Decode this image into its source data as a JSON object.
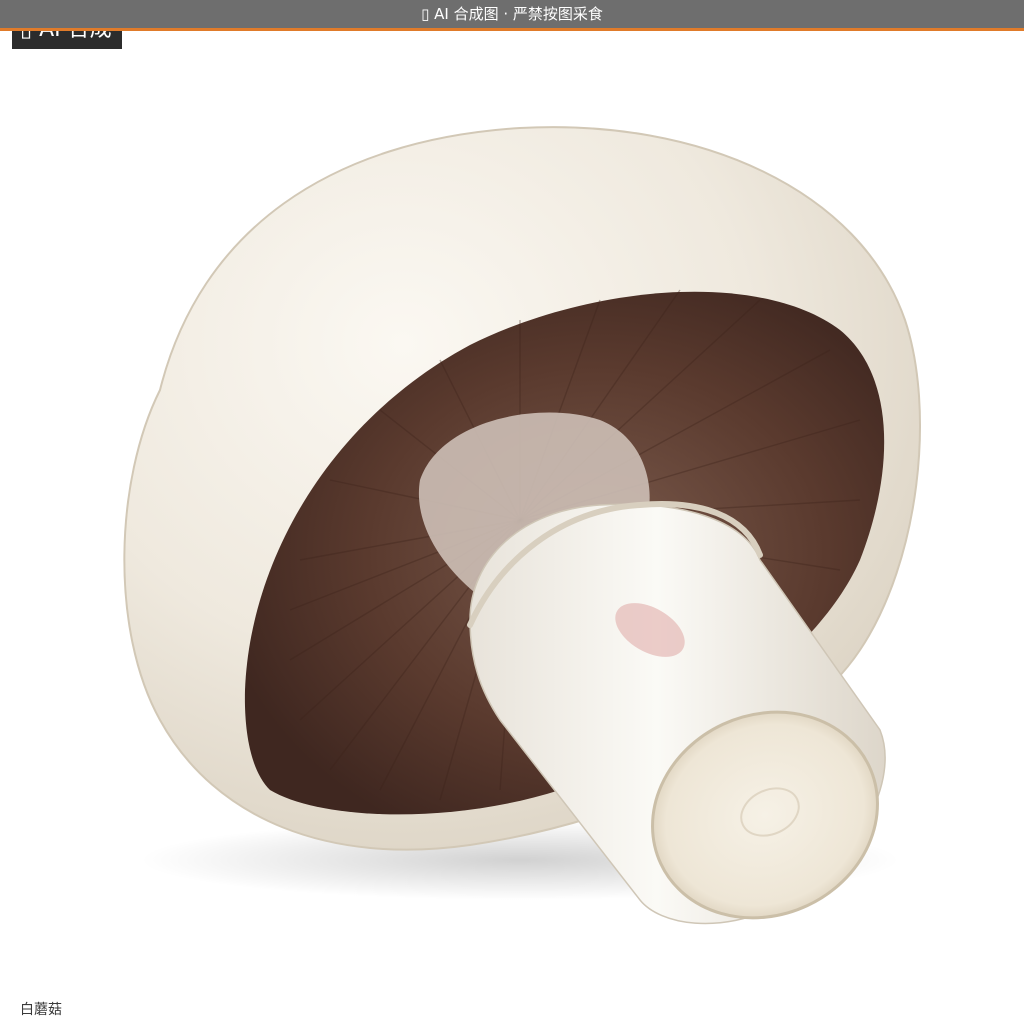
{
  "banner": {
    "text": "▯ AI 合成图 · 严禁按图采食",
    "bg_color": "#6e6e6e",
    "accent_color": "#e07b2a"
  },
  "badge": {
    "text": "▯ AI 合成"
  },
  "image": {
    "subject": "mushroom-illustration"
  },
  "caption": {
    "text": "白蘑菇"
  }
}
